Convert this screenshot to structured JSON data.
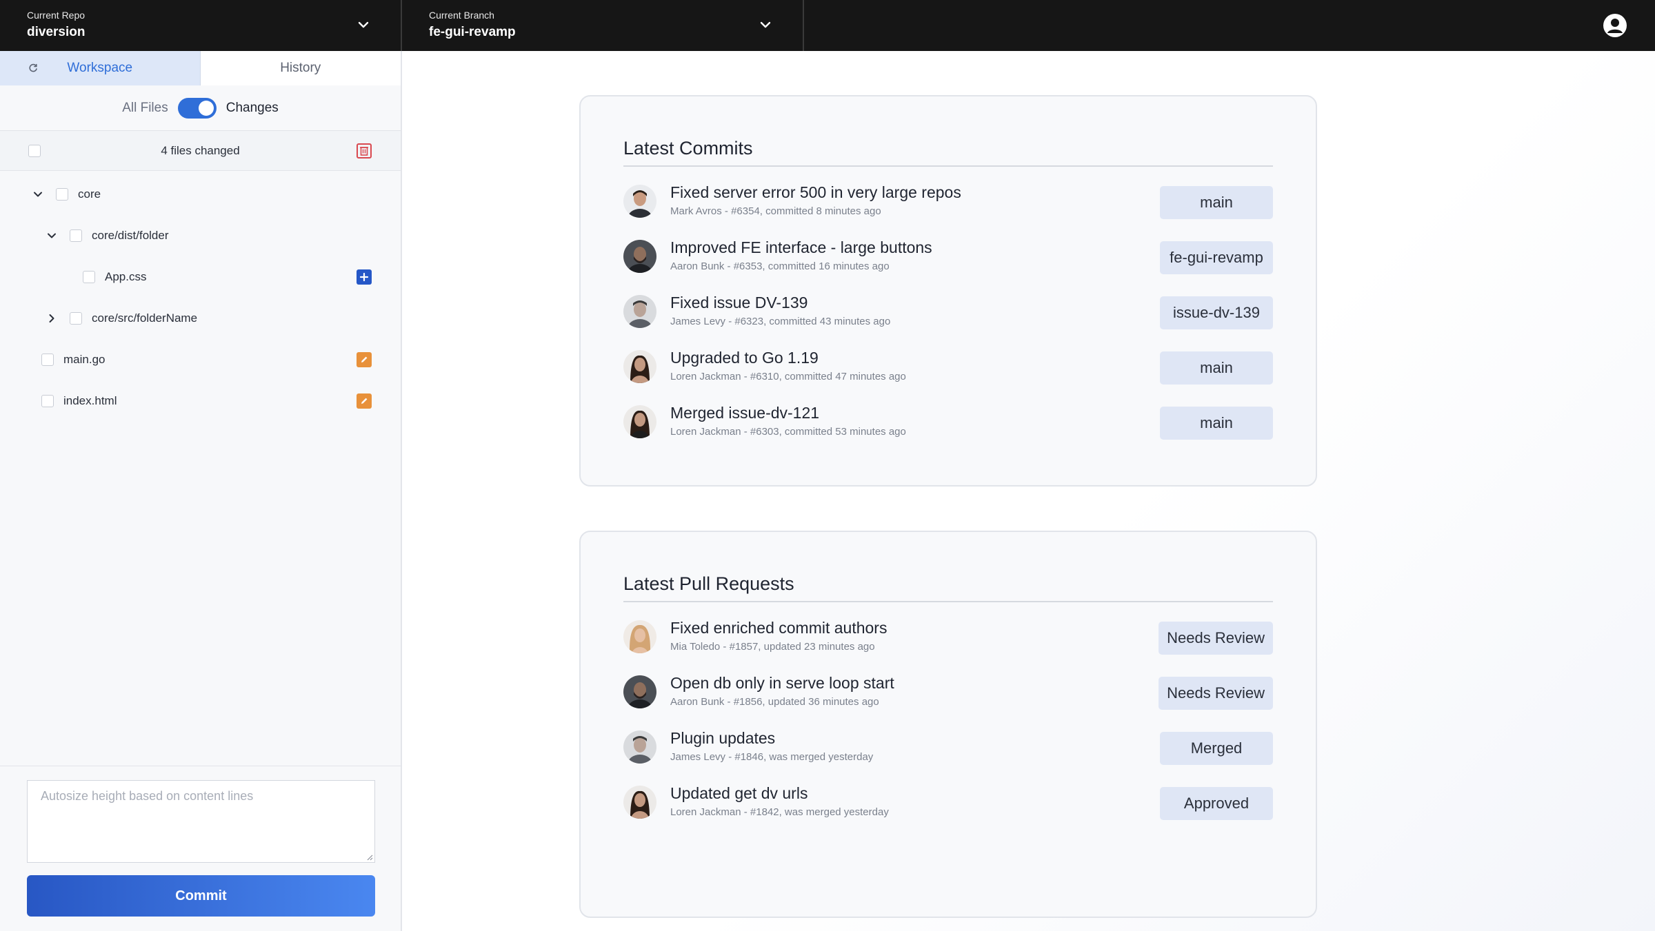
{
  "topbar": {
    "repo": {
      "label": "Current Repo",
      "value": "diversion"
    },
    "branch": {
      "label": "Current Branch",
      "value": "fe-gui-revamp"
    }
  },
  "sidebar": {
    "tabs": [
      {
        "label": "Workspace",
        "active": true
      },
      {
        "label": "History",
        "active": false
      }
    ],
    "toggle": {
      "off_label": "All Files",
      "on_label": "Changes",
      "on": true
    },
    "changes_count": "4 files changed",
    "tree": [
      {
        "name": "core",
        "type": "folder",
        "expanded": true
      },
      {
        "name": "core/dist/folder",
        "type": "folder",
        "expanded": true
      },
      {
        "name": "App.css",
        "type": "file",
        "status": "added"
      },
      {
        "name": "core/src/folderName",
        "type": "folder",
        "expanded": false
      },
      {
        "name": "main.go",
        "type": "file",
        "status": "modified"
      },
      {
        "name": "index.html",
        "type": "file",
        "status": "modified"
      }
    ],
    "commit_placeholder": "Autosize height based on content lines",
    "commit_button": "Commit"
  },
  "commits": {
    "title": "Latest Commits",
    "items": [
      {
        "title": "Fixed server error 500 in very large repos",
        "meta": "Mark Avros - #6354, committed 8 minutes ago",
        "tag": "main"
      },
      {
        "title": "Improved FE interface - large buttons",
        "meta": "Aaron Bunk - #6353, committed 16 minutes ago",
        "tag": "fe-gui-revamp"
      },
      {
        "title": "Fixed issue DV-139",
        "meta": "James Levy - #6323, committed 43  minutes ago",
        "tag": "issue-dv-139"
      },
      {
        "title": "Upgraded to Go 1.19",
        "meta": "Loren Jackman - #6310, committed 47 minutes ago",
        "tag": "main"
      },
      {
        "title": "Merged issue-dv-121",
        "meta": "Loren Jackman - #6303, committed 53 minutes ago",
        "tag": "main"
      }
    ]
  },
  "pull_requests": {
    "title": "Latest Pull Requests",
    "items": [
      {
        "title": "Fixed enriched commit authors",
        "meta": "Mia Toledo - #1857, updated 23 minutes ago",
        "tag": "Needs Review"
      },
      {
        "title": "Open db only in serve loop start",
        "meta": "Aaron Bunk - #1856, updated 36 minutes ago",
        "tag": "Needs Review"
      },
      {
        "title": "Plugin updates",
        "meta": "James Levy - #1846, was merged yesterday",
        "tag": "Merged"
      },
      {
        "title": "Updated get dv urls",
        "meta": "Loren Jackman - #1842, was merged yesterday",
        "tag": "Approved"
      }
    ]
  },
  "colors": {
    "accent": "#2f6ed8",
    "added": "#2557c7",
    "modified": "#e8913a",
    "danger": "#d9484f",
    "topbar": "#161616"
  }
}
